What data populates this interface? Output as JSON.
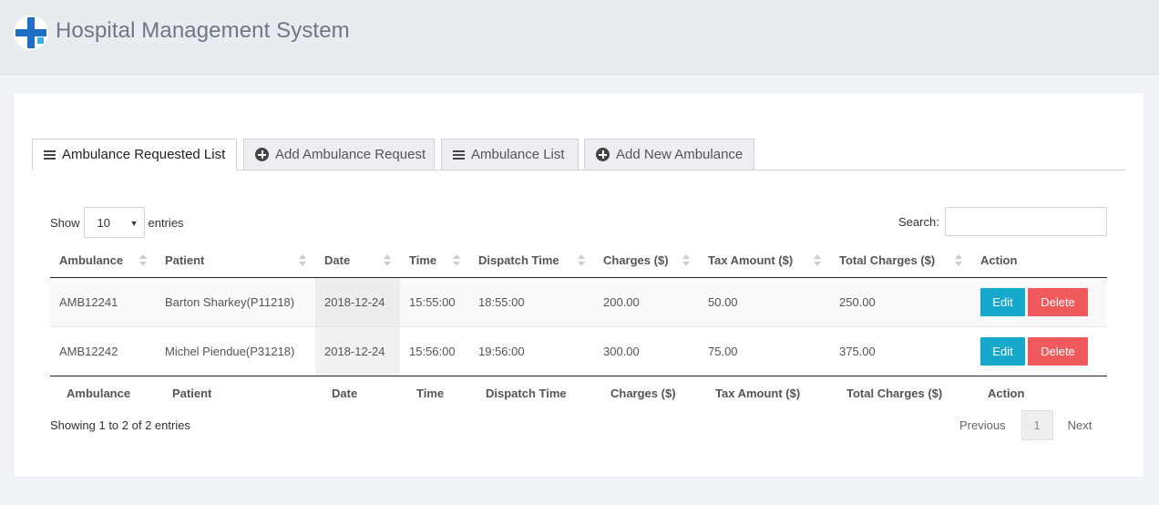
{
  "header": {
    "title": "Hospital Management System"
  },
  "tabs": [
    {
      "label": "Ambulance Requested List",
      "icon": "list-icon",
      "active": true
    },
    {
      "label": "Add Ambulance Request",
      "icon": "plus-circle-icon",
      "active": false
    },
    {
      "label": "Ambulance List",
      "icon": "list-icon",
      "active": false
    },
    {
      "label": "Add New Ambulance",
      "icon": "plus-circle-icon",
      "active": false
    }
  ],
  "length": {
    "prefix": "Show",
    "value": "10",
    "suffix": "entries"
  },
  "search": {
    "label": "Search:",
    "value": ""
  },
  "table": {
    "columns": [
      "Ambulance",
      "Patient",
      "Date",
      "Time",
      "Dispatch Time",
      "Charges ($)",
      "Tax Amount ($)",
      "Total Charges ($)",
      "Action"
    ],
    "rows": [
      {
        "ambulance": "AMB12241",
        "patient": "Barton Sharkey(P11218)",
        "date": "2018-12-24",
        "time": "15:55:00",
        "dispatch": "18:55:00",
        "charges": "200.00",
        "tax": "50.00",
        "total": "250.00"
      },
      {
        "ambulance": "AMB12242",
        "patient": "Michel Piendue(P31218)",
        "date": "2018-12-24",
        "time": "15:56:00",
        "dispatch": "19:56:00",
        "charges": "300.00",
        "tax": "75.00",
        "total": "375.00"
      }
    ],
    "edit_label": "Edit",
    "delete_label": "Delete"
  },
  "footer": {
    "info": "Showing 1 to 2 of 2 entries",
    "previous": "Previous",
    "page": "1",
    "next": "Next"
  },
  "colors": {
    "edit": "#17a9cc",
    "delete": "#f05a5d",
    "logo": "#1f6fc4"
  }
}
